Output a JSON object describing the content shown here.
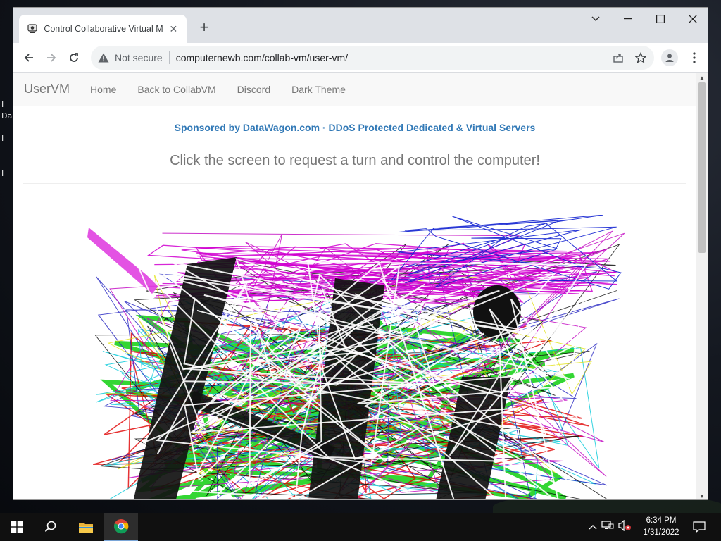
{
  "desktop": {
    "labels": [
      "I",
      "Da",
      "I",
      "I"
    ]
  },
  "browser": {
    "tab_title": "Control Collaborative Virtual Mac",
    "security_text": "Not secure",
    "url": "computernewb.com/collab-vm/user-vm/"
  },
  "navbar": {
    "brand": "UserVM",
    "links": [
      "Home",
      "Back to CollabVM",
      "Discord",
      "Dark Theme"
    ]
  },
  "page": {
    "sponsor": "Sponsored by DataWagon.com · DDoS Protected Dedicated & Virtual Servers",
    "lead": "Click the screen to request a turn and control the computer!"
  },
  "taskbar": {
    "time": "6:34 PM",
    "date": "1/31/2022"
  },
  "colors": {
    "link": "#337ab7",
    "navbar_bg": "#f8f8f8",
    "muted_text": "#777777"
  }
}
